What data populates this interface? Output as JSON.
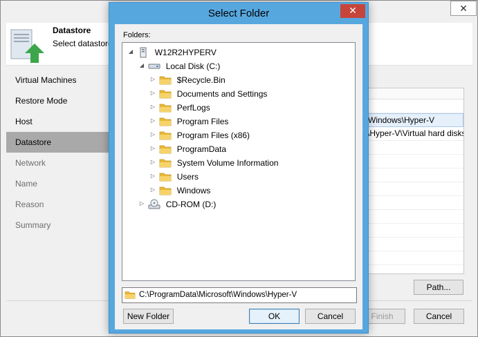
{
  "wizard": {
    "close_glyph": "✕",
    "header_title": "Datastore",
    "header_subtitle": "Select datastores",
    "steps": [
      {
        "label": "Virtual Machines",
        "state": "done"
      },
      {
        "label": "Restore Mode",
        "state": "done"
      },
      {
        "label": "Host",
        "state": "done"
      },
      {
        "label": "Datastore",
        "state": "active"
      },
      {
        "label": "Network",
        "state": "pending"
      },
      {
        "label": "Name",
        "state": "pending"
      },
      {
        "label": "Reason",
        "state": "pending"
      },
      {
        "label": "Summary",
        "state": "pending"
      }
    ],
    "table_rows": [
      "Windows\\Hyper-V",
      "\\Hyper-V\\Virtual hard disks"
    ],
    "path_button": "Path...",
    "finish_button": "Finish",
    "cancel_button": "Cancel"
  },
  "dialog": {
    "title": "Select Folder",
    "close_glyph": "✕",
    "folders_label": "Folders:",
    "tree": [
      {
        "label": "W12R2HYPERV",
        "icon": "computer-icon",
        "level": 0,
        "expander": "expanded"
      },
      {
        "label": "Local Disk (C:)",
        "icon": "drive-icon",
        "level": 1,
        "expander": "expanded"
      },
      {
        "label": "$Recycle.Bin",
        "icon": "folder-icon",
        "level": 2,
        "expander": "collapsed"
      },
      {
        "label": "Documents and Settings",
        "icon": "folder-icon",
        "level": 2,
        "expander": "collapsed"
      },
      {
        "label": "PerfLogs",
        "icon": "folder-icon",
        "level": 2,
        "expander": "collapsed"
      },
      {
        "label": "Program Files",
        "icon": "folder-icon",
        "level": 2,
        "expander": "collapsed"
      },
      {
        "label": "Program Files (x86)",
        "icon": "folder-icon",
        "level": 2,
        "expander": "collapsed"
      },
      {
        "label": "ProgramData",
        "icon": "folder-icon",
        "level": 2,
        "expander": "collapsed"
      },
      {
        "label": "System Volume Information",
        "icon": "folder-icon",
        "level": 2,
        "expander": "collapsed"
      },
      {
        "label": "Users",
        "icon": "folder-icon",
        "level": 2,
        "expander": "collapsed"
      },
      {
        "label": "Windows",
        "icon": "folder-icon",
        "level": 2,
        "expander": "collapsed"
      },
      {
        "label": "CD-ROM (D:)",
        "icon": "cdrom-icon",
        "level": 1,
        "expander": "collapsed"
      }
    ],
    "selected_path": "C:\\ProgramData\\Microsoft\\Windows\\Hyper-V",
    "new_folder_button": "New Folder",
    "ok_button": "OK",
    "cancel_button": "Cancel"
  },
  "colors": {
    "dialog_frame": "#57a7df",
    "close_red": "#c7443a",
    "folder_yellow": "#e8b935",
    "active_step": "#a9a9a9"
  }
}
